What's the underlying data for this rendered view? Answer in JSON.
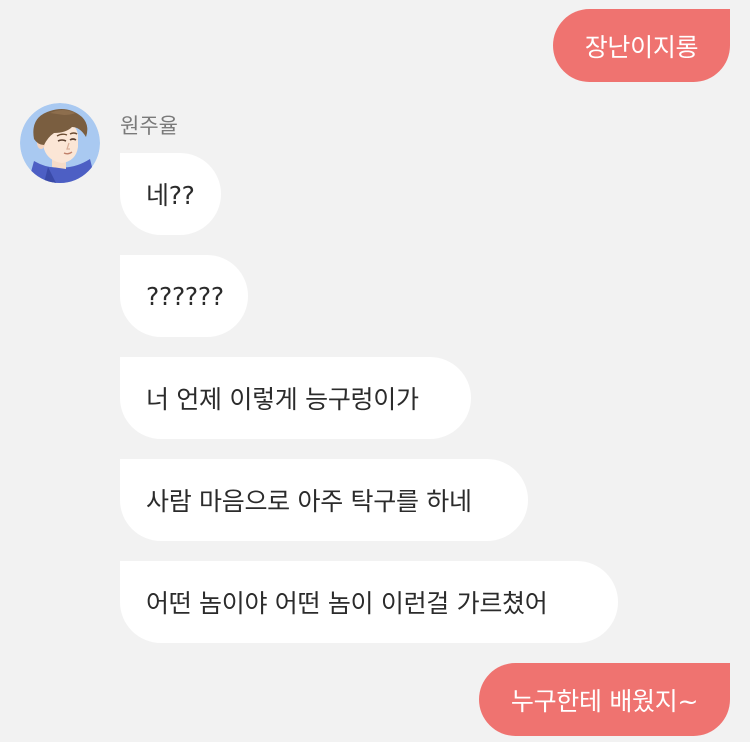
{
  "chat": {
    "outgoing": [
      {
        "text": "장난이지롱"
      },
      {
        "text": "누구한테 배웠지~"
      }
    ],
    "contact": {
      "name": "원주율",
      "avatar_icon": "cartoon-boy-avatar-icon"
    },
    "incoming": [
      {
        "text": "네??"
      },
      {
        "text": "??????"
      },
      {
        "text": "너 언제 이렇게 능구렁이가"
      },
      {
        "text": "사람 마음으로 아주 탁구를 하네"
      },
      {
        "text": "어떤 놈이야 어떤 놈이 이런걸 가르쳤어"
      }
    ]
  },
  "colors": {
    "background": "#f2f2f2",
    "outgoing_bubble": "#ef7370",
    "incoming_bubble": "#ffffff",
    "sender_name": "#7a7a7a"
  }
}
